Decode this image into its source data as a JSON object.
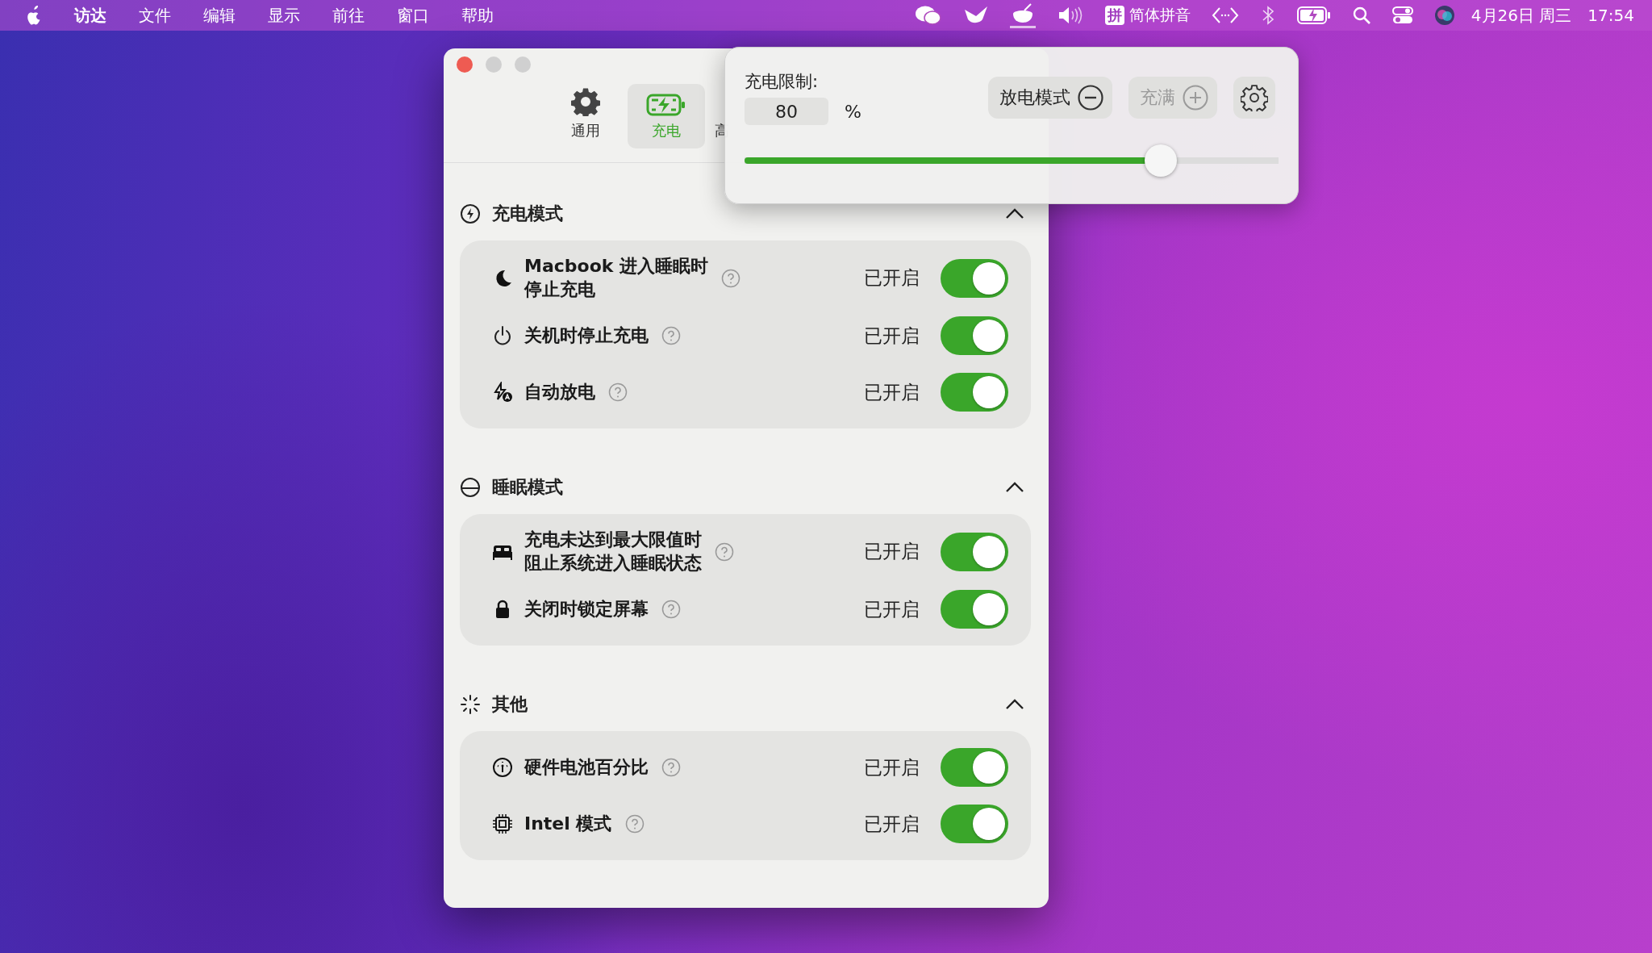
{
  "menu_bar": {
    "app_menus": [
      {
        "label": "访达",
        "bold": true
      },
      {
        "label": "文件",
        "bold": false
      },
      {
        "label": "编辑",
        "bold": false
      },
      {
        "label": "显示",
        "bold": false
      },
      {
        "label": "前往",
        "bold": false
      },
      {
        "label": "窗口",
        "bold": false
      },
      {
        "label": "帮助",
        "bold": false
      }
    ],
    "input_method": {
      "badge": "拼",
      "label": "简体拼音"
    },
    "date": "4月26日 周三",
    "time": "17:54"
  },
  "window": {
    "tabs": [
      {
        "label": "通用",
        "kind": "gear",
        "selected": false
      },
      {
        "label": "充电",
        "kind": "battery",
        "selected": true
      },
      {
        "label": "高",
        "kind": "text",
        "selected": false
      }
    ],
    "sections": [
      {
        "title": "充电模式",
        "kind": "bolt",
        "expanded": true,
        "rows": [
          {
            "kind": "moon",
            "lines": [
              "Macbook 进入睡眠时",
              "停止充电"
            ],
            "status": "已开启",
            "on": true
          },
          {
            "kind": "power",
            "lines": [
              "关机时停止充电"
            ],
            "status": "已开启",
            "on": true
          },
          {
            "kind": "auto",
            "lines": [
              "自动放电"
            ],
            "status": "已开启",
            "on": true
          }
        ]
      },
      {
        "title": "睡眠模式",
        "kind": "half",
        "expanded": true,
        "rows": [
          {
            "kind": "bed",
            "lines": [
              "充电未达到最大限值时",
              "阻止系统进入睡眠状态"
            ],
            "status": "已开启",
            "on": true
          },
          {
            "kind": "lock",
            "lines": [
              "关闭时锁定屏幕"
            ],
            "status": "已开启",
            "on": true
          }
        ]
      },
      {
        "title": "其他",
        "kind": "sparkle",
        "expanded": true,
        "rows": [
          {
            "kind": "gauge",
            "lines": [
              "硬件电池百分比"
            ],
            "status": "已开启",
            "on": true
          },
          {
            "kind": "chip",
            "lines": [
              "Intel 模式"
            ],
            "status": "已开启",
            "on": true
          }
        ]
      }
    ]
  },
  "popover": {
    "limit_label": "充电限制:",
    "limit_value": "80",
    "unit": "%",
    "discharge_button": "放电模式",
    "full_button": "充满",
    "full_disabled": true,
    "slider": {
      "level": 0.78
    }
  }
}
